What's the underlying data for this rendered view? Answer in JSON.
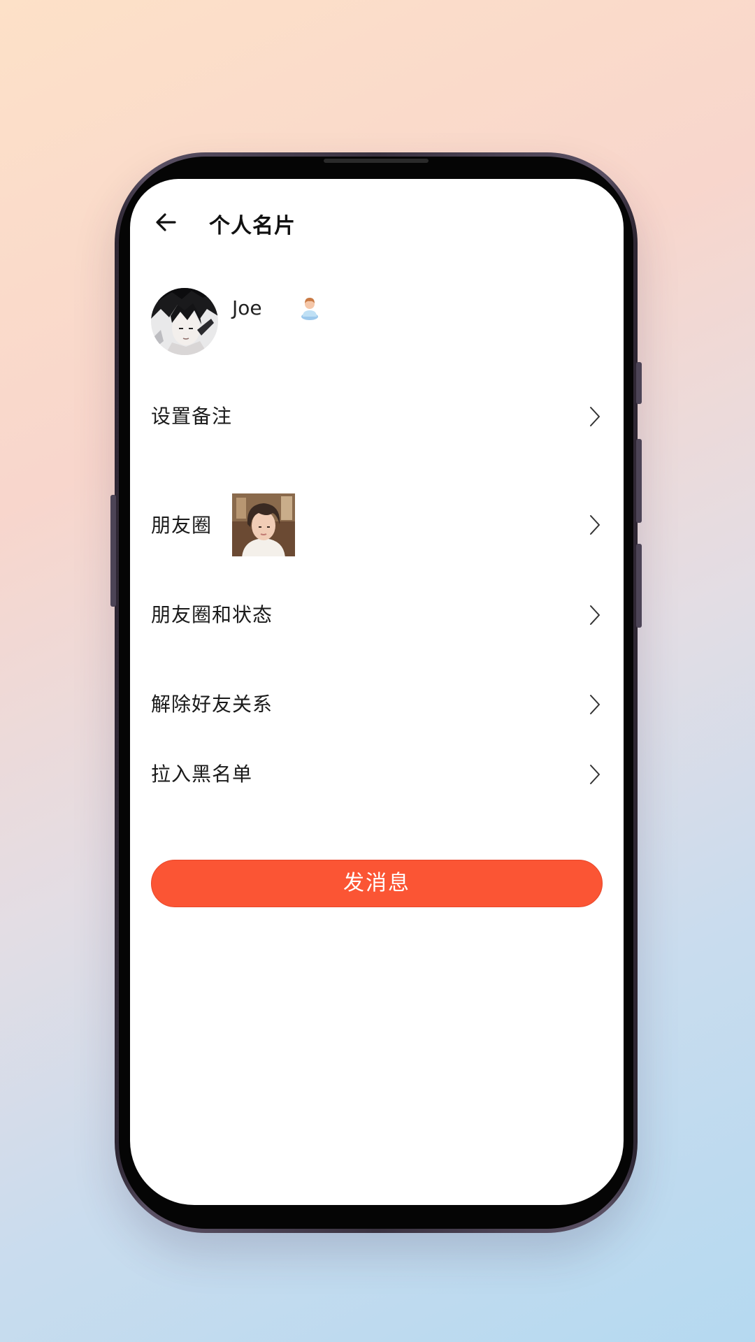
{
  "header": {
    "back_icon": "arrow-left-icon",
    "title": "个人名片"
  },
  "profile": {
    "name": "Joe",
    "gender_icon": "male-user-icon"
  },
  "menu": {
    "items": [
      {
        "label": "设置备注",
        "icon": "chevron-right-icon"
      },
      {
        "label": "朋友圈",
        "icon": "chevron-right-icon"
      },
      {
        "label": "朋友圈和状态",
        "icon": "chevron-right-icon"
      },
      {
        "label": "解除好友关系",
        "icon": "chevron-right-icon"
      },
      {
        "label": "拉入黑名单",
        "icon": "chevron-right-icon"
      }
    ]
  },
  "actions": {
    "send_message_label": "发消息"
  },
  "colors": {
    "accent": "#fb5534",
    "text": "#1a1a1a",
    "screen_bg": "#ffffff"
  }
}
